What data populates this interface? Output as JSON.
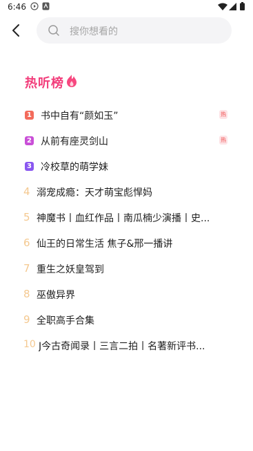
{
  "status_bar": {
    "time": "6:46"
  },
  "search": {
    "placeholder": "搜你想看的"
  },
  "hot_list": {
    "title": "热听榜",
    "items": [
      {
        "rank": "1",
        "title": "书中自有“颜如玉”",
        "tag": "热",
        "badge_color": "#f36b5b"
      },
      {
        "rank": "2",
        "title": "从前有座灵剑山",
        "tag": "热",
        "badge_color": "#c94fd7"
      },
      {
        "rank": "3",
        "title": "冷校草的萌学妹",
        "tag": "",
        "badge_color": "#8a57f0"
      },
      {
        "rank": "4",
        "title": "溺宠成瘾：天才萌宝彪悍妈",
        "tag": ""
      },
      {
        "rank": "5",
        "title": "神魔书丨血红作品丨南瓜楠少演播丨史...",
        "tag": ""
      },
      {
        "rank": "6",
        "title": "仙王的日常生活  焦子&邢一播讲",
        "tag": ""
      },
      {
        "rank": "7",
        "title": "重生之妖皇驾到",
        "tag": ""
      },
      {
        "rank": "8",
        "title": "巫傲异界",
        "tag": ""
      },
      {
        "rank": "9",
        "title": "全职高手合集",
        "tag": ""
      },
      {
        "rank": "10",
        "title": "J今古奇闻录丨三言二拍丨名著新评书...",
        "tag": ""
      }
    ]
  },
  "colors": {
    "accent": "#f23c7a",
    "rank_plain": "#f4c88f",
    "hot_tag_text": "#f04b4b",
    "hot_tag_bg": "#fde3e6"
  }
}
